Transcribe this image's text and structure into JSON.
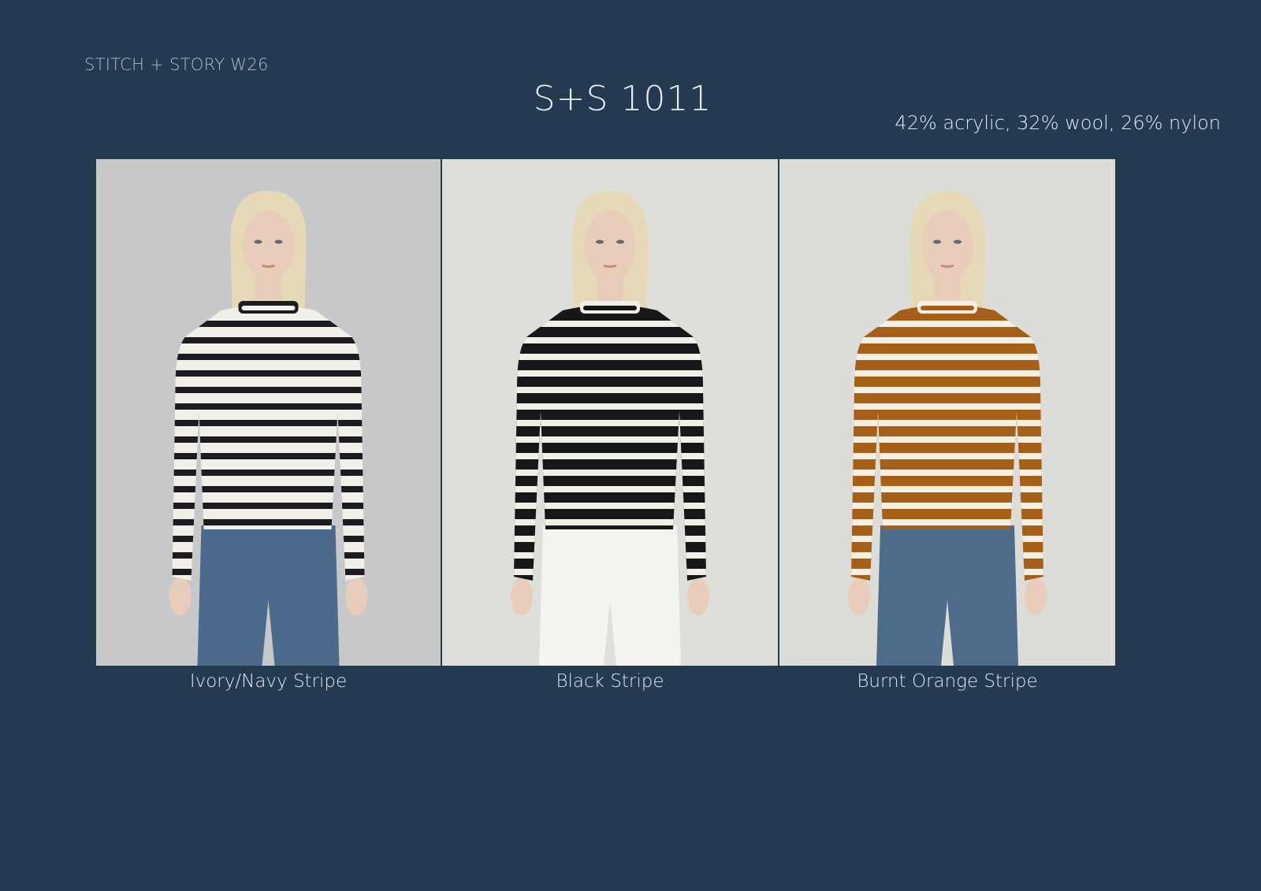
{
  "header": {
    "brand": "STITCH  + STORY W26",
    "style_number": "S+S 1011",
    "composition": "42% acrylic, 32% wool, 26% nylon"
  },
  "colorways": [
    {
      "name": "Ivory/Navy Stripe",
      "backdrop": "#c6c8ca",
      "sweater_base": "#f1efe8",
      "sweater_stripe": "#1b1b20",
      "pants": "#4d6a8c"
    },
    {
      "name": "Black Stripe",
      "backdrop": "#dedfda",
      "sweater_base": "#17171a",
      "sweater_stripe": "#f2efe6",
      "pants": "#f4f3ef"
    },
    {
      "name": "Burnt Orange Stripe",
      "backdrop": "#dcddd8",
      "sweater_base": "#a55f16",
      "sweater_stripe": "#f4efe2",
      "pants": "#4e6b8c"
    }
  ],
  "colors": {
    "page_background": "#243a51",
    "hair": "#e6d9b8",
    "skin": "#e9cdbb"
  }
}
